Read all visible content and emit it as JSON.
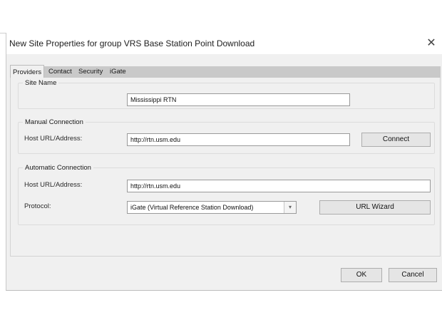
{
  "dialog": {
    "title": "New Site Properties for group VRS Base Station Point Download",
    "close_glyph": "✕"
  },
  "tabs": [
    {
      "label": "Providers",
      "active": true
    },
    {
      "label": "Contact",
      "active": false
    },
    {
      "label": "Security",
      "active": false
    },
    {
      "label": "iGate",
      "active": false
    }
  ],
  "site_name": {
    "legend": "Site Name",
    "value": "Mississippi RTN"
  },
  "manual_connection": {
    "legend": "Manual Connection",
    "host_label": "Host URL/Address:",
    "host_value": "http://rtn.usm.edu",
    "connect_label": "Connect"
  },
  "automatic_connection": {
    "legend": "Automatic Connection",
    "host_label": "Host URL/Address:",
    "host_value": "http://rtn.usm.edu",
    "protocol_label": "Protocol:",
    "protocol_value": "iGate (Virtual Reference Station Download)",
    "wizard_label": "URL Wizard"
  },
  "footer": {
    "ok_label": "OK",
    "cancel_label": "Cancel"
  }
}
